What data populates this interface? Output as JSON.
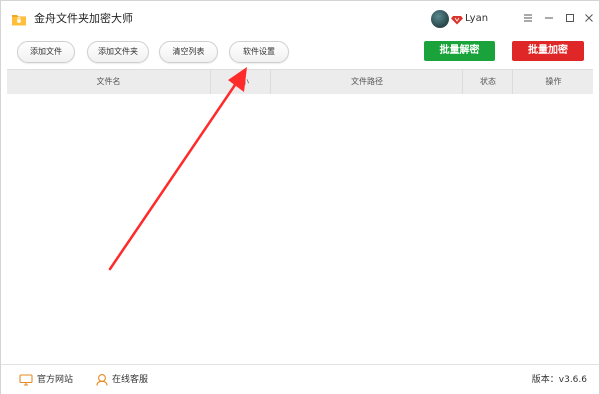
{
  "app": {
    "title": "金舟文件夹加密大师",
    "user_name": "Lyan"
  },
  "toolbar": {
    "add_file": "添加文件",
    "add_folder": "添加文件夹",
    "clear_list": "清空列表",
    "settings": "软件设置",
    "batch_decrypt": "批量解密",
    "batch_encrypt": "批量加密"
  },
  "table": {
    "headers": [
      "文件名",
      "大小",
      "文件路径",
      "状态",
      "操作"
    ],
    "rows": []
  },
  "statusbar": {
    "official_site": "官方网站",
    "online_service": "在线客服",
    "version": "版本：v3.6.6"
  },
  "colors": {
    "decrypt": "#1aa33a",
    "encrypt": "#e02727",
    "arrow": "#ff2a2a",
    "header_bg": "#ececec"
  },
  "icons": {
    "app": "folder-lock-icon",
    "vip": "vip-diamond-icon",
    "site": "monitor-icon",
    "service": "headset-icon"
  }
}
